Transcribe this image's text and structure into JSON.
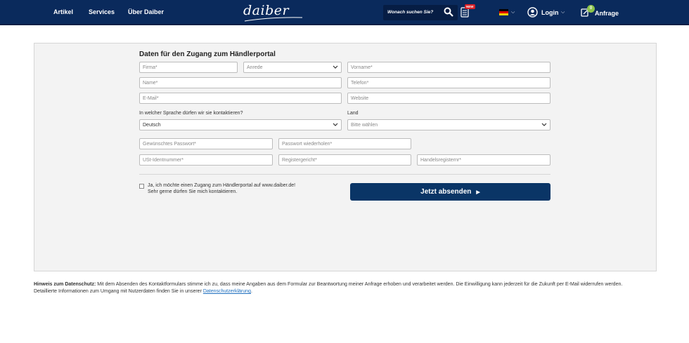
{
  "header": {
    "nav": [
      "Artikel",
      "Services",
      "Über Daiber"
    ],
    "logo_text": "daiber",
    "search_placeholder": "Wonach suchen Sie?",
    "new_badge": "NEW",
    "login_label": "Login",
    "anfrage_label": "Anfrage",
    "anfrage_count": "0",
    "colors": {
      "bar": "#0a2a5c",
      "badge_new": "#d81f26",
      "badge_count": "#8bc34a"
    },
    "icons": [
      "search-icon",
      "list-icon",
      "flag-de-icon",
      "user-icon",
      "request-icon"
    ]
  },
  "form": {
    "title": "Daten für den Zugang zum Händlerportal",
    "firma": "Firma*",
    "anrede": "Anrede",
    "vorname": "Vorname*",
    "name": "Name*",
    "telefon": "Telefon*",
    "email": "E-Mail*",
    "website": "Website",
    "language_label": "In welcher Sprache dürfen wir sie kontaktieren?",
    "language_value": "Deutsch",
    "land_label": "Land",
    "land_placeholder": "Bitte wählen",
    "passwort": "Gewünschtes Passwort*",
    "passwort_repeat": "Passwort wiederholen*",
    "ust": "USt-Identnummer*",
    "registergericht": "Registergericht*",
    "handelsregister": "Handelsregisternr*",
    "consent_line1": "Ja, ich möchte einen Zugang zum Händlerportal auf www.daiber.de!",
    "consent_line2": "Sehr gerne dürfen Sie mich kontaktieren.",
    "submit_label": "Jetzt absenden",
    "submit_color": "#0a3566"
  },
  "privacy": {
    "heading": "Hinweis zum Datenschutz:",
    "text": " Mit dem Absenden des Kontaktformulars stimme ich zu, dass meine Angaben aus dem Formular zur Beantwortung meiner Anfrage erhoben und verarbeitet werden. Die Einwilligung kann jederzeit für die Zukunft per E-Mail widerrufen werden. Detaillierte Informationen zum Umgang mit Nutzerdaten finden Sie in unserer ",
    "link": "Datenschutzerklärung",
    "end": "."
  }
}
